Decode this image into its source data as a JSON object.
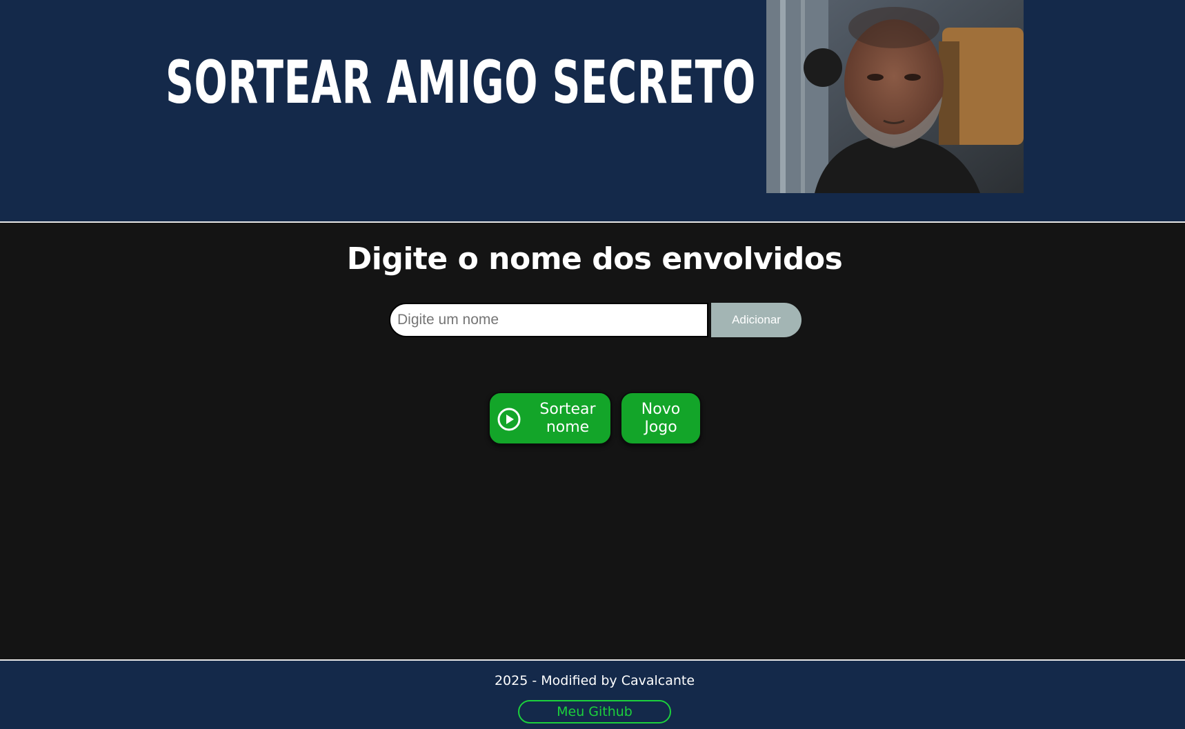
{
  "header": {
    "title": "SORTEAR AMIGO SECRETO",
    "photo": "person-photo"
  },
  "main": {
    "subtitle": "Digite o nome dos envolvidos",
    "name_input": {
      "value": "",
      "placeholder": "Digite um nome"
    },
    "add_button": "Adicionar",
    "draw_button": {
      "label": "Sortear\nnome",
      "icon": "play-circle-icon"
    },
    "new_game_button": "Novo\nJogo"
  },
  "footer": {
    "text": "2025 - Modified by Cavalcante",
    "github_link": "Meu Github"
  },
  "colors": {
    "header_bg": "#14294a",
    "main_bg": "#141414",
    "green": "#13a529",
    "link_green": "#1cd13c",
    "add_button_bg": "#a3b5b4"
  }
}
